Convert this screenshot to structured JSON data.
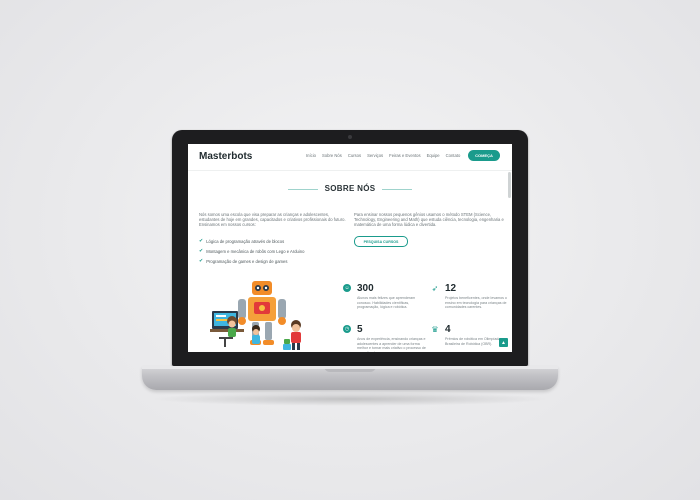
{
  "site": {
    "logo": "Masterbots",
    "menu": [
      "Início",
      "Sobre Nós",
      "Cursos",
      "Serviços",
      "Feiras e Eventos",
      "Equipe",
      "Contato"
    ],
    "cta": "COMEÇA",
    "section_title": "SOBRE NÓS",
    "intro_left": "Nós somos uma escola que visa preparar as crianças e adolescentes, estudantes de hoje em grandes, capacitados e criativos profissionais do futuro. Ensinamos em nossos cursos:",
    "checklist": [
      "Lógica de programação através de blocos",
      "Montagem e mecânica de robôs com Lego e Arduino",
      "Programação de games e design de games"
    ],
    "intro_right": "Para ensinar nossos pequenos gênios usamos o método STEM (Science, Technology, Engineering and Math) que estuda ciência, tecnologia, engenharia e matemática de uma forma lúdica e divertida.",
    "outline_button": "PESQUISA CURSOS",
    "stats": [
      {
        "icon": "smile-icon",
        "number": "300",
        "desc": "Alunos mais felizes que aprenderam conosco. Habilidades científicas, programação, lógica e robótica."
      },
      {
        "icon": "rocket-icon",
        "number": "12",
        "desc": "Projetos beneficentes, onde levamos o ensino em tecnologia para crianças de comunidades carentes."
      },
      {
        "icon": "clock-icon",
        "number": "5",
        "desc": "Anos de experiência, ensinando crianças e adolescentes a aprender de uma forma melhor e tornar mais criativo o processo de aprendizado."
      },
      {
        "icon": "trophy-icon",
        "number": "4",
        "desc": "Prêmios de robótica em Olimpíada Brasileira de Robótica (OBR)."
      }
    ],
    "back_to_top": "▲"
  },
  "colors": {
    "accent": "#1a9b8c",
    "lid": "#1d1d1f",
    "background": "#ececee"
  }
}
